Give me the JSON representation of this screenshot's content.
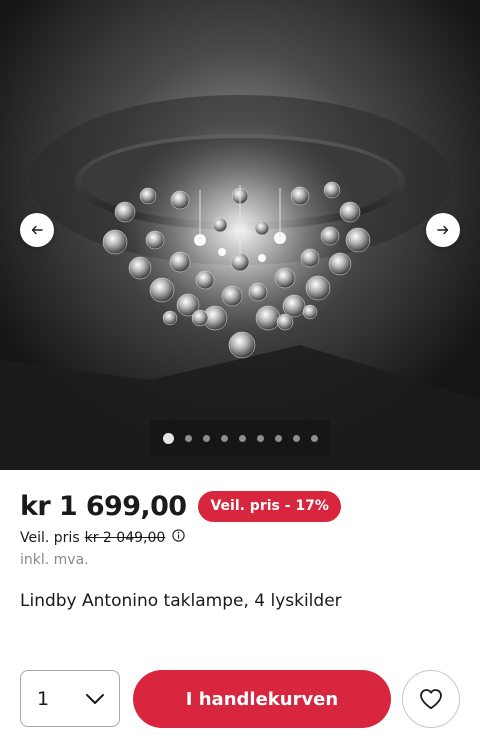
{
  "gallery": {
    "image_alt": "Lindby Antonino taklampe",
    "prev_icon": "arrow-left-icon",
    "next_icon": "arrow-right-icon",
    "slide_count": 9,
    "active_slide": 1
  },
  "product": {
    "price": "kr 1 699,00",
    "discount_badge": "Veil. pris - 17%",
    "rrp_label": "Veil. pris",
    "rrp_value": "kr 2 049,00",
    "vat_note": "inkl. mva.",
    "title": "Lindby Antonino taklampe, 4 lyskilder"
  },
  "purchase": {
    "quantity": "1",
    "add_to_cart_label": "I handlekurven",
    "wishlist_icon": "heart-icon"
  },
  "colors": {
    "accent": "#d7263d",
    "text": "#1a1a1a",
    "muted": "#8a8a8a"
  }
}
